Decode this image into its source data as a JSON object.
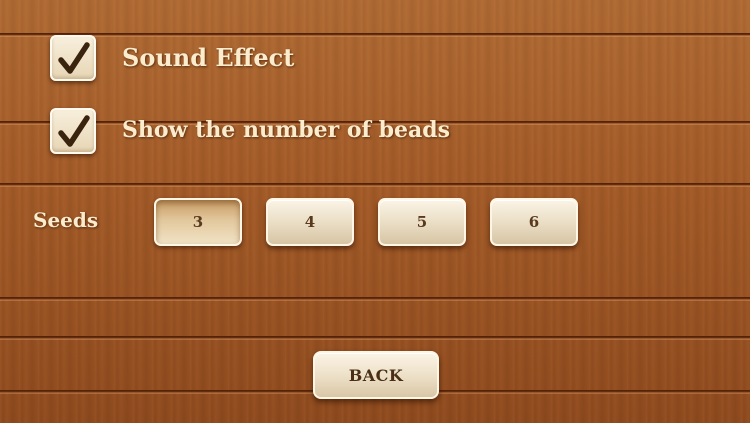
{
  "settings": {
    "sound_effect": {
      "label": "Sound Effect",
      "checked": true
    },
    "show_beads": {
      "label": "Show the number of beads",
      "checked": true
    }
  },
  "seeds": {
    "label": "Seeds",
    "options": [
      "3",
      "4",
      "5",
      "6"
    ],
    "selected": "3"
  },
  "back_label": "BACK",
  "colors": {
    "wood": "#a35a27",
    "label_text": "#fbeccd",
    "button_face": "#f1e6d0",
    "button_text": "#5a3a1f"
  }
}
